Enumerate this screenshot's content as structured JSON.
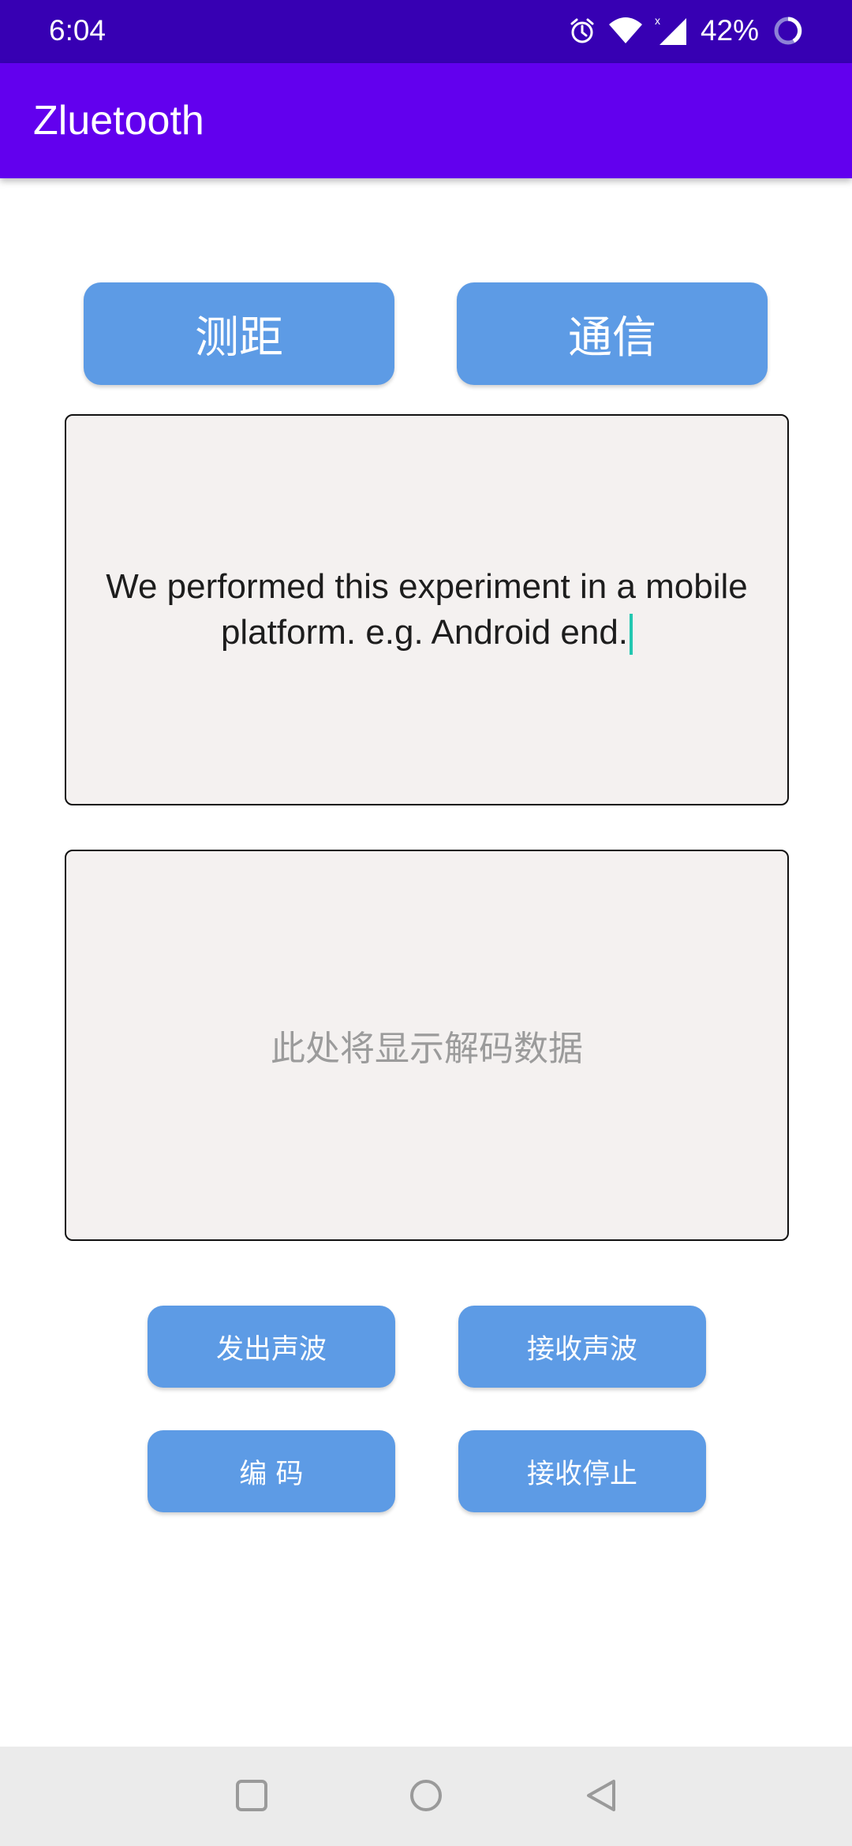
{
  "status_bar": {
    "time": "6:04",
    "battery": "42%",
    "icons": [
      "alarm-icon",
      "wifi-icon",
      "cell-signal-icon",
      "battery-ring-icon"
    ]
  },
  "app_bar": {
    "title": "Zluetooth",
    "color": "#6200ee"
  },
  "top_buttons": {
    "ranging": "测距",
    "communication": "通信"
  },
  "input_box": {
    "value": "We performed this experiment in a mobile platform. e.g. Android end."
  },
  "output_box": {
    "placeholder": "此处将显示解码数据"
  },
  "actions": {
    "emit_wave": "发出声波",
    "receive_wave": "接收声波",
    "encode": "编 码",
    "stop_receive": "接收停止"
  },
  "colors": {
    "status_bar": "#3700b3",
    "button": "#5d9be5",
    "caret": "#22c7b0"
  },
  "nav_bar": {
    "icons": [
      "recents-square-icon",
      "home-circle-icon",
      "back-triangle-icon"
    ]
  }
}
